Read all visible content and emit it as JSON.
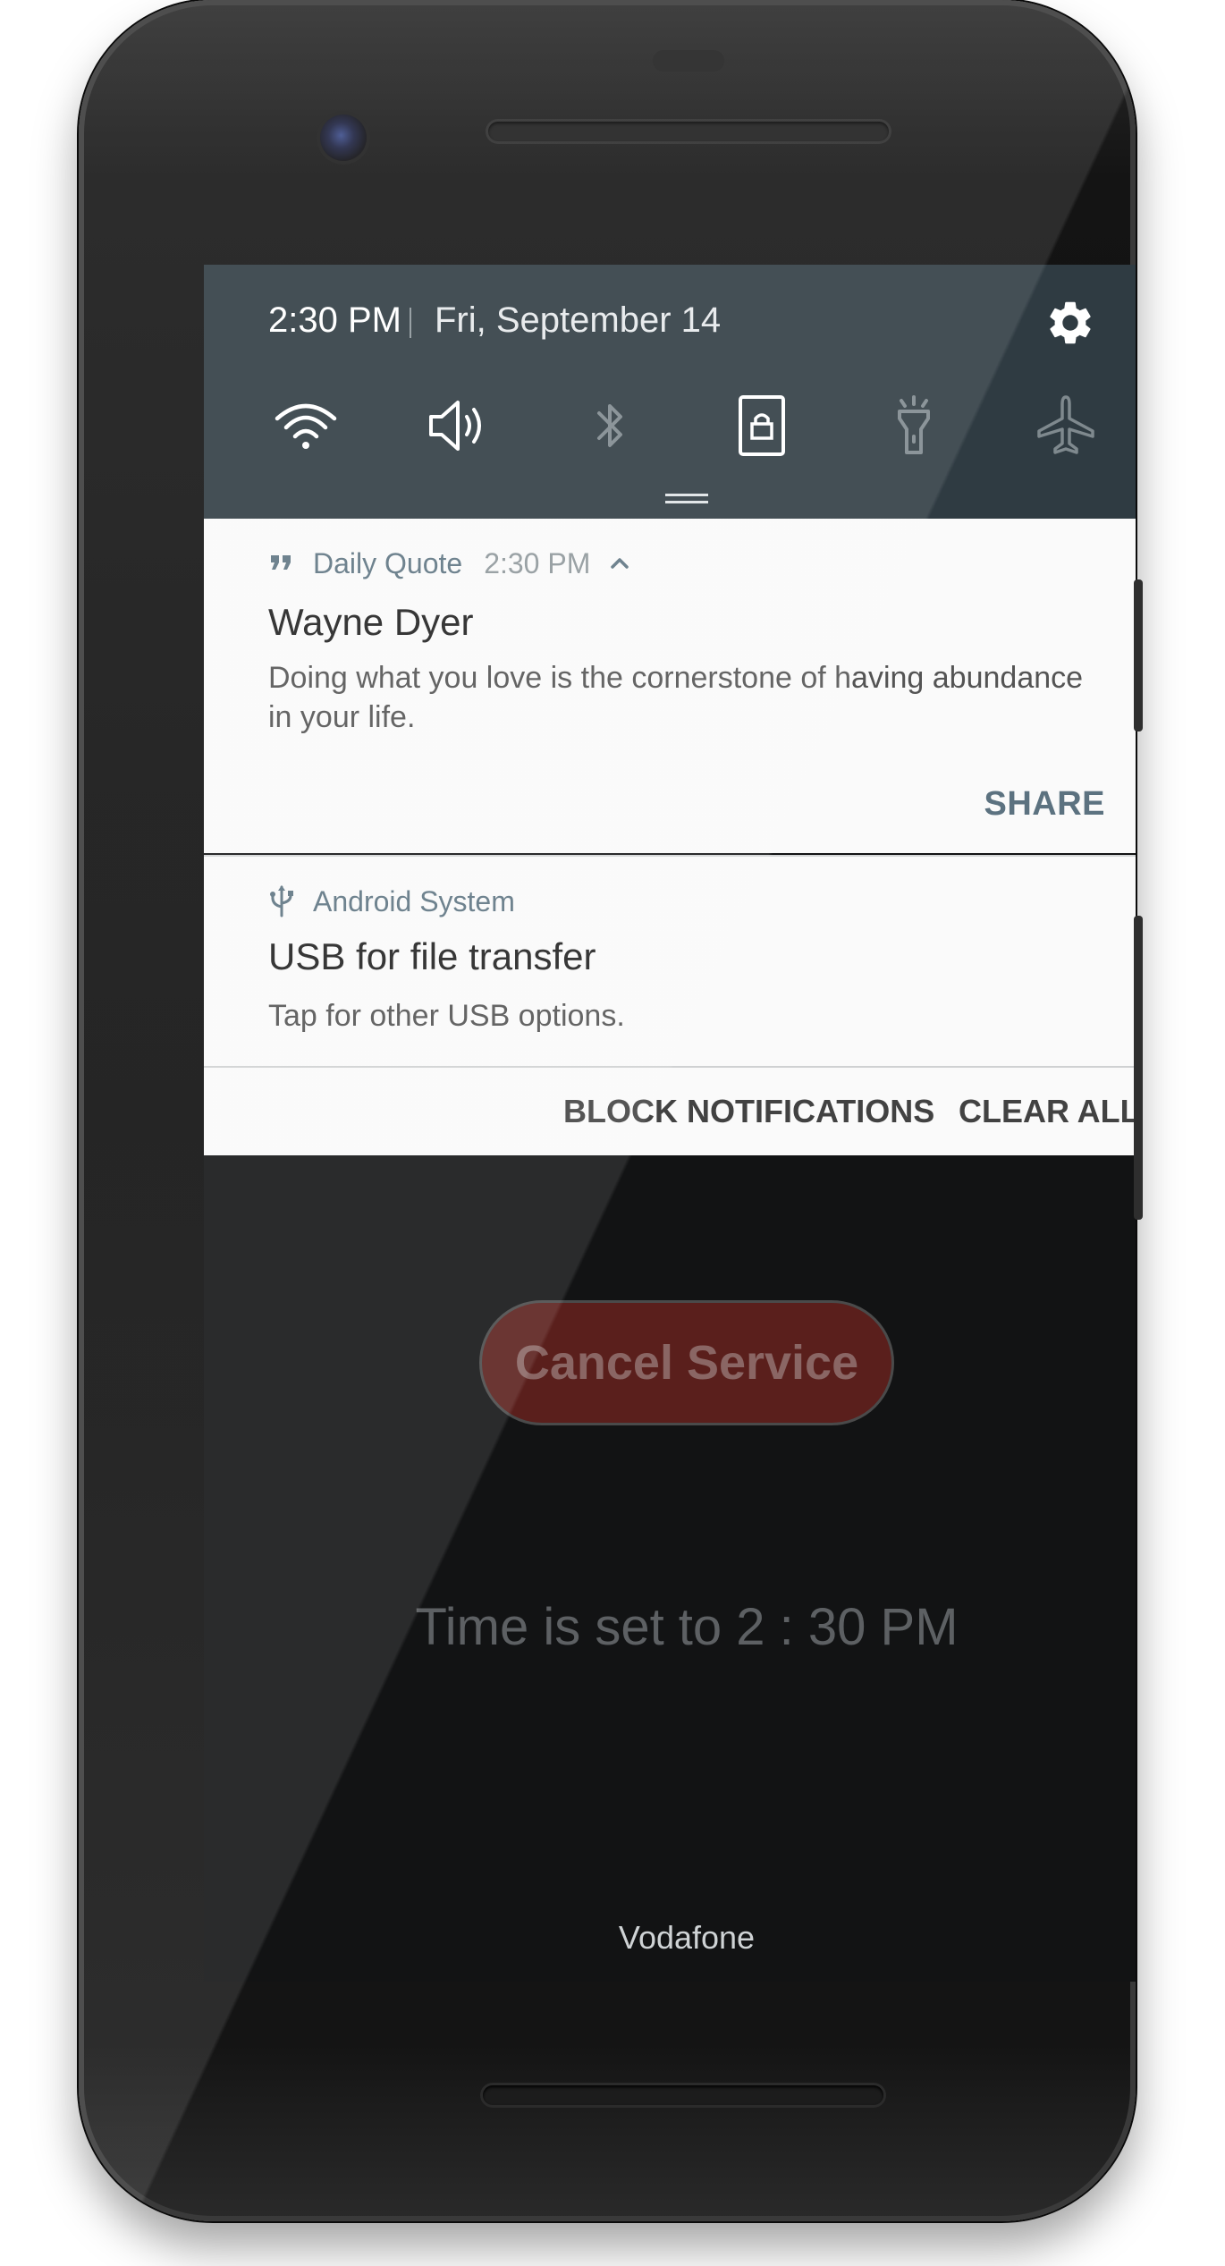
{
  "status": {
    "time": "2:30 PM",
    "date": "Fri, September 14"
  },
  "quick_settings": {
    "tiles": [
      {
        "icon": "wifi-icon",
        "active": true
      },
      {
        "icon": "volume-icon",
        "active": true
      },
      {
        "icon": "bluetooth-icon",
        "active": false
      },
      {
        "icon": "screen-lock-icon",
        "active": true
      },
      {
        "icon": "flashlight-icon",
        "active": false
      },
      {
        "icon": "airplane-icon",
        "active": false
      }
    ]
  },
  "notifications": [
    {
      "icon": "quote-icon",
      "app": "Daily Quote",
      "time": "2:30 PM",
      "title": "Wayne Dyer",
      "text": "Doing what you love is the cornerstone of having abundance in your life.",
      "action": "SHARE"
    },
    {
      "icon": "usb-icon",
      "app": "Android System",
      "title": "USB for file transfer",
      "text": "Tap for other USB options."
    }
  ],
  "footer": {
    "block_label": "BLOCK NOTIFICATIONS",
    "clear_label": "CLEAR ALL"
  },
  "app": {
    "cancel_button": "Cancel Service",
    "time_text": "Time is set to 2 : 30 PM"
  },
  "carrier": "Vodafone",
  "colors": {
    "qs_background": "#2f3b42",
    "accent": "#5c7280",
    "cancel_button": "#5a1f1c"
  }
}
